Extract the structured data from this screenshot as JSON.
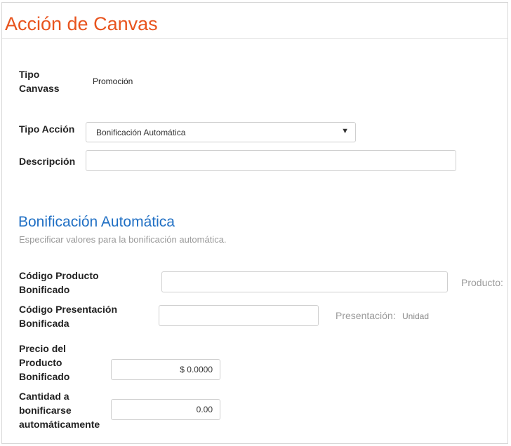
{
  "header": {
    "title": "Acción de Canvas"
  },
  "form": {
    "tipo_canvass": {
      "label_line1": "Tipo",
      "label_line2": "Canvass",
      "value": "Promoción"
    },
    "tipo_accion": {
      "label": "Tipo Acción",
      "selected": "Bonificación Automática"
    },
    "descripcion": {
      "label": "Descripción",
      "value": ""
    }
  },
  "section": {
    "title": "Bonificación Automática",
    "subtitle": "Especificar valores para la bonificación automática.",
    "codigo_producto": {
      "label_line1": "Código Producto",
      "label_line2": "Bonificado",
      "value": "",
      "hint": "Producto:"
    },
    "codigo_presentacion": {
      "label_line1": "Código Presentación",
      "label_line2": "Bonificada",
      "value": "",
      "hint": "Presentación:",
      "hint_value": "Unidad"
    },
    "precio": {
      "label_line1": "Precio del",
      "label_line2": "Producto",
      "label_line3": "Bonificado",
      "value": "$ 0.0000"
    },
    "cantidad": {
      "label_line1": "Cantidad a",
      "label_line2": "bonificarse",
      "label_line3": "automáticamente",
      "value": "0.00"
    }
  },
  "icons": {
    "dropdown": "chevron-down-icon"
  },
  "colors": {
    "title": "#e8541e",
    "section_title": "#1f6fc4",
    "muted": "#9a9a9a"
  }
}
